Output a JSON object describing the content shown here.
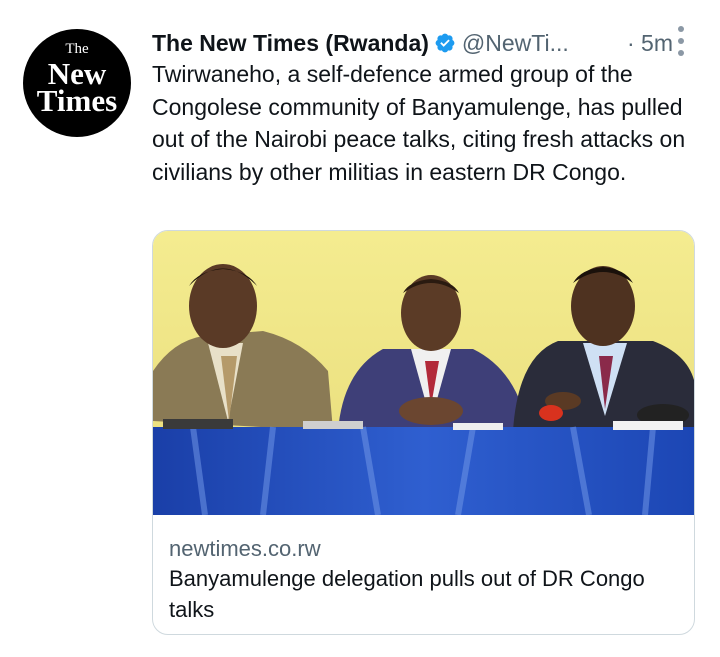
{
  "account": {
    "avatar_line1": "The",
    "avatar_line2": "New",
    "avatar_line3": "Times",
    "display_name": "The New Times (Rwanda)",
    "handle": "@NewTi...",
    "time": "· 5m",
    "verified_icon": "verified-badge-icon",
    "verified_color": "#1d9bf0"
  },
  "tweet": {
    "text": "Twirwaneho, a self-defence armed group of the Congolese community of Banyamulenge, has pulled out of the Nairobi peace talks, citing fresh attacks on civilians by other militias in eastern DR Congo."
  },
  "card": {
    "domain": "newtimes.co.rw",
    "title": "Banyamulenge delegation pulls out of DR Congo talks"
  },
  "colors": {
    "text": "#0f1419",
    "secondary": "#536471",
    "border": "#cfd9de"
  }
}
